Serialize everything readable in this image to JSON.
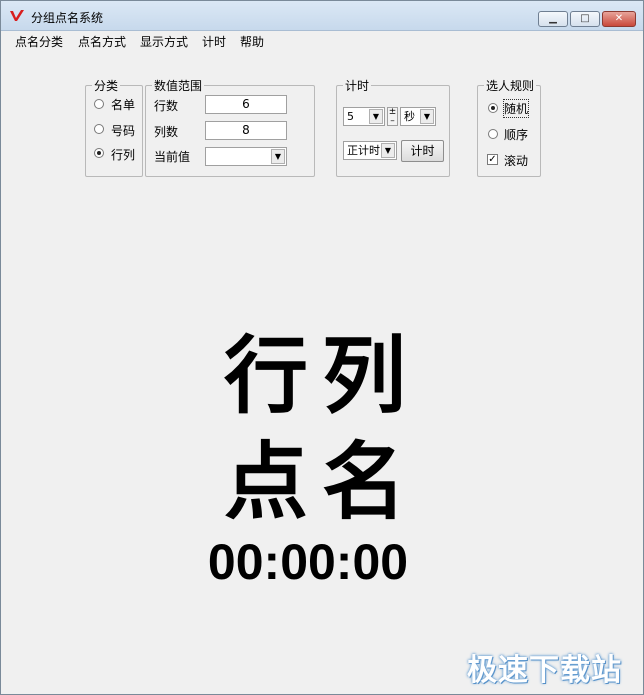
{
  "window": {
    "title": "分组点名系统"
  },
  "menu": [
    "点名分类",
    "点名方式",
    "显示方式",
    "计时",
    "帮助"
  ],
  "category": {
    "legend": "分类",
    "options": [
      {
        "label": "名单",
        "selected": false
      },
      {
        "label": "号码",
        "selected": false
      },
      {
        "label": "行列",
        "selected": true
      }
    ]
  },
  "range": {
    "legend": "数值范围",
    "rows_label": "行数",
    "rows_value": "6",
    "cols_label": "列数",
    "cols_value": "8",
    "current_label": "当前值",
    "current_value": ""
  },
  "timing": {
    "legend": "计时",
    "amount": "5",
    "spin_up": "±",
    "unit": "秒",
    "mode": "正计时",
    "button": "计时"
  },
  "rules": {
    "legend": "选人规则",
    "random_label": "随机",
    "random_selected": true,
    "sequential_label": "顺序",
    "sequential_selected": false,
    "scroll_label": "滚动",
    "scroll_checked": true
  },
  "display": {
    "line1": "行列",
    "line2": "点名",
    "timer": "00:00:00"
  },
  "watermark": "极速下载站"
}
